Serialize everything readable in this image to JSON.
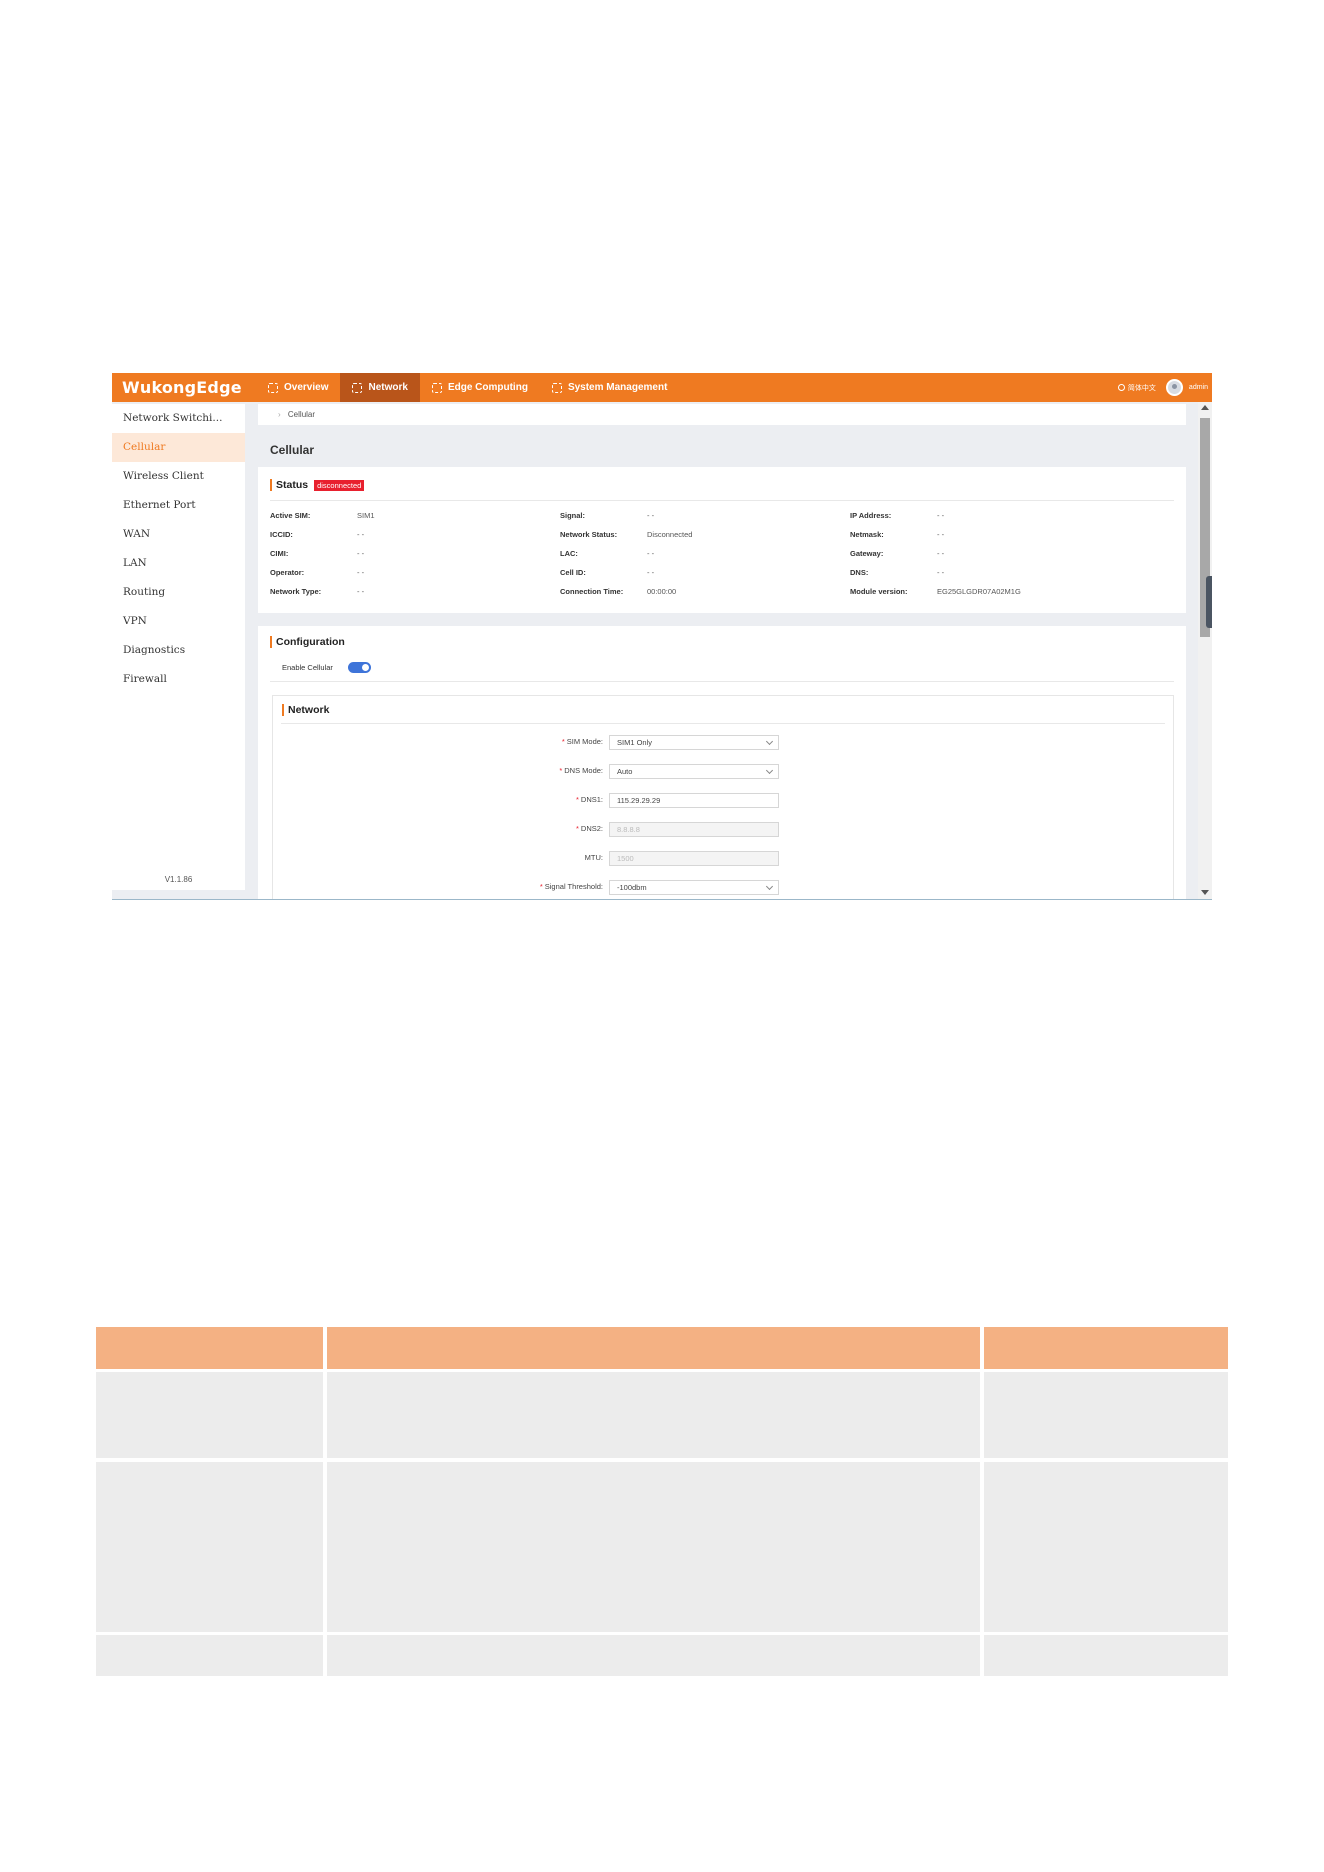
{
  "app": {
    "logo": "WukongEdge",
    "nav": [
      "Overview",
      "Network",
      "Edge Computing",
      "System Management"
    ],
    "active_nav": "Network",
    "language": "简体中文",
    "user": "admin"
  },
  "sidebar": {
    "items": [
      "Network Switchi...",
      "Cellular",
      "Wireless Client",
      "Ethernet Port",
      "WAN",
      "LAN",
      "Routing",
      "VPN",
      "Diagnostics",
      "Firewall"
    ],
    "active": "Cellular",
    "version": "V1.1.86"
  },
  "breadcrumb": "Cellular",
  "page_title": "Cellular",
  "status": {
    "title": "Status",
    "badge": "disconnected",
    "col1": [
      {
        "label": "Active SIM:",
        "value": "SIM1"
      },
      {
        "label": "ICCID:",
        "value": "- -"
      },
      {
        "label": "CIMI:",
        "value": "- -"
      },
      {
        "label": "Operator:",
        "value": "- -"
      },
      {
        "label": "Network Type:",
        "value": "- -"
      }
    ],
    "col2": [
      {
        "label": "Signal:",
        "value": "- -"
      },
      {
        "label": "Network Status:",
        "value": "Disconnected"
      },
      {
        "label": "LAC:",
        "value": "- -"
      },
      {
        "label": "Cell ID:",
        "value": "- -"
      },
      {
        "label": "Connection Time:",
        "value": "00:00:00"
      }
    ],
    "col3": [
      {
        "label": "IP Address:",
        "value": "- -"
      },
      {
        "label": "Netmask:",
        "value": "- -"
      },
      {
        "label": "Gateway:",
        "value": "- -"
      },
      {
        "label": "DNS:",
        "value": "- -"
      },
      {
        "label": "Module version:",
        "value": "EG25GLGDR07A02M1G"
      }
    ]
  },
  "configuration": {
    "title": "Configuration",
    "enable_label": "Enable Cellular",
    "enabled": true,
    "network_title": "Network",
    "fields": [
      {
        "label": "SIM Mode:",
        "required": "*",
        "value": "SIM1 Only",
        "type": "select"
      },
      {
        "label": "DNS Mode:",
        "required": "*",
        "value": "Auto",
        "type": "select"
      },
      {
        "label": "DNS1:",
        "required": "*",
        "value": "115.29.29.29",
        "type": "input"
      },
      {
        "label": "DNS2:",
        "required": "*",
        "value": "8.8.8.8",
        "type": "disabled"
      },
      {
        "label": "MTU:",
        "required": "",
        "value": "1500",
        "type": "disabled"
      },
      {
        "label": "Signal Threshold:",
        "required": "*",
        "value": "-100dbm",
        "type": "select"
      }
    ]
  },
  "colors": {
    "brand": "#ef7a21",
    "brand_dark": "#b9551a",
    "error": "#e8202e",
    "toggle": "#3e74d9",
    "table_header": "#f4b183",
    "table_row": "#ececec"
  }
}
